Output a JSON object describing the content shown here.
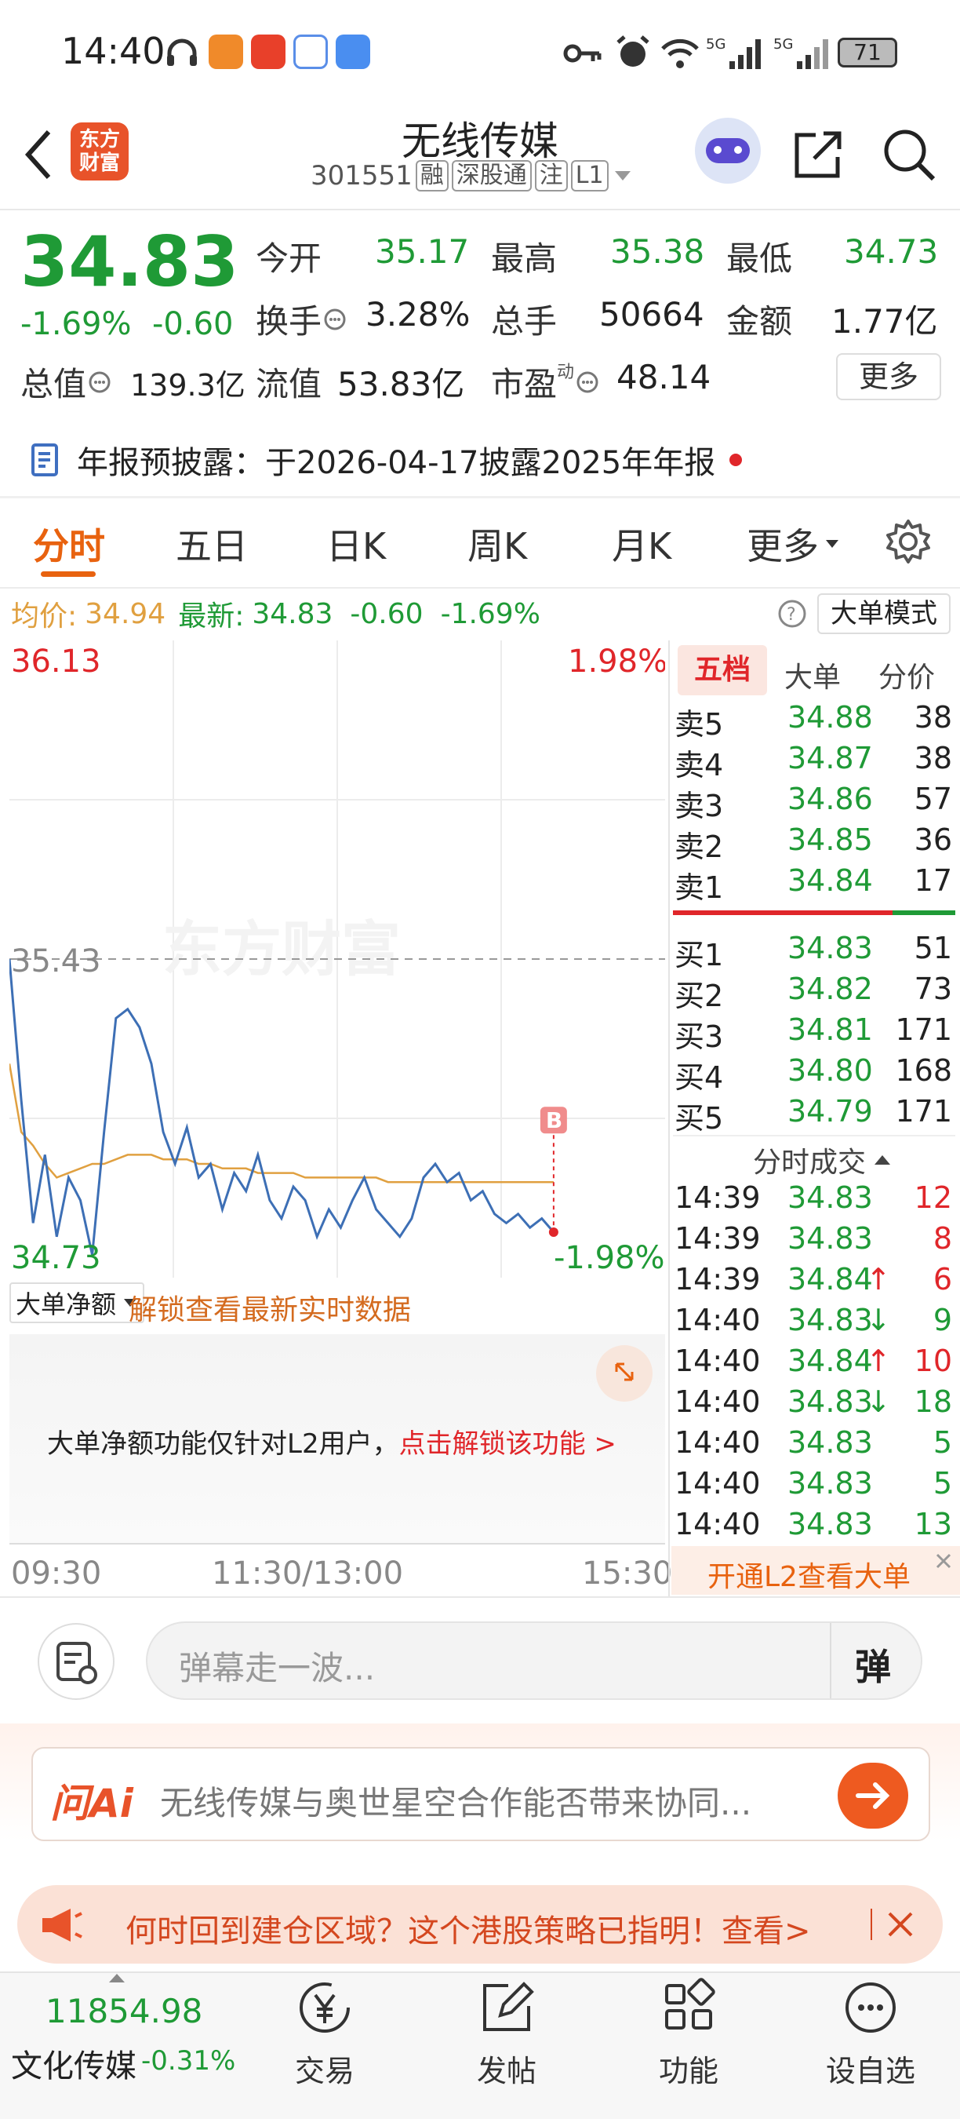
{
  "status_bar": {
    "time": "14:40",
    "battery": "71"
  },
  "header": {
    "logo_text": "东方\n财富",
    "stock_name": "无线传媒",
    "stock_code": "301551",
    "tags": [
      "融",
      "深股通",
      "注",
      "L1"
    ]
  },
  "quote": {
    "price": "34.83",
    "change_pct": "-1.69%",
    "change": "-0.60",
    "fields": [
      {
        "label": "今开",
        "value": "35.17"
      },
      {
        "label": "最高",
        "value": "35.38"
      },
      {
        "label": "最低",
        "value": "34.73"
      },
      {
        "label": "换手",
        "value": "3.28%"
      },
      {
        "label": "总手",
        "value": "50664"
      },
      {
        "label": "金额",
        "value": "1.77亿"
      },
      {
        "label": "总值",
        "value": "139.3亿"
      },
      {
        "label": "流值",
        "value": "53.83亿"
      },
      {
        "label": "市盈",
        "value": "48.14",
        "sup": "动"
      }
    ],
    "more_button": "更多"
  },
  "notice": {
    "text": "年报预披露：于2026-04-17披露2025年年报"
  },
  "tabs": {
    "items": [
      "分时",
      "五日",
      "日K",
      "周K",
      "月K",
      "更多"
    ],
    "active": 0
  },
  "info_line": {
    "avg_label": "均价:",
    "avg_value": "34.94",
    "latest_label": "最新:",
    "latest_value": "34.83",
    "change": "-0.60",
    "change_pct": "-1.69%",
    "mode_button": "大单模式"
  },
  "chart_labels": {
    "top_price": "36.13",
    "top_pct": "1.98%",
    "mid_price": "35.43",
    "bottom_price": "34.73",
    "bottom_pct": "-1.98%",
    "watermark": "东方财富",
    "b_marker": "B",
    "time_start": "09:30",
    "time_mid": "11:30/13:00",
    "time_end": "15:30"
  },
  "chart_data": {
    "type": "line",
    "xlabel": "",
    "ylabel": "",
    "ylim": [
      34.73,
      36.13
    ],
    "series": [
      {
        "values": [
          35.43,
          35.12,
          34.85,
          35.0,
          34.82,
          34.95,
          34.9,
          34.78,
          35.05,
          35.3,
          35.32,
          35.28,
          35.2,
          35.05,
          34.98,
          35.06,
          34.95,
          34.98,
          34.88,
          34.96,
          34.92,
          35.0,
          34.9,
          34.86,
          34.93,
          34.9,
          34.82,
          34.88,
          34.84,
          34.9,
          34.95,
          34.88,
          34.85,
          34.82,
          34.86,
          34.95,
          34.98,
          34.94,
          34.96,
          34.9,
          34.92,
          34.87,
          34.85,
          34.87,
          34.84,
          34.86,
          34.83
        ]
      },
      {
        "values": [
          35.2,
          35.05,
          35.02,
          34.98,
          34.95,
          34.96,
          34.97,
          34.98,
          34.98,
          34.99,
          35.0,
          35.0,
          35.0,
          34.99,
          34.99,
          34.99,
          34.98,
          34.98,
          34.97,
          34.97,
          34.97,
          34.96,
          34.96,
          34.96,
          34.96,
          34.95,
          34.95,
          34.95,
          34.95,
          34.95,
          34.95,
          34.95,
          34.94,
          34.94,
          34.94,
          34.94,
          34.94,
          34.94,
          34.94,
          34.94,
          34.94,
          34.94,
          34.94,
          34.94,
          34.94,
          34.94,
          34.94
        ]
      }
    ]
  },
  "sub_chart": {
    "dropdown": "大单净额",
    "unlock_link": "解锁查看最新实时数据",
    "notice_text": "大单净额功能仅针对L2用户，",
    "notice_link": "点击解锁该功能 >"
  },
  "orderbook": {
    "tabs": [
      "五档",
      "大单",
      "分价"
    ],
    "sell": [
      {
        "label": "卖5",
        "price": "34.88",
        "vol": "38"
      },
      {
        "label": "卖4",
        "price": "34.87",
        "vol": "38"
      },
      {
        "label": "卖3",
        "price": "34.86",
        "vol": "57"
      },
      {
        "label": "卖2",
        "price": "34.85",
        "vol": "36"
      },
      {
        "label": "卖1",
        "price": "34.84",
        "vol": "17"
      }
    ],
    "buy": [
      {
        "label": "买1",
        "price": "34.83",
        "vol": "51"
      },
      {
        "label": "买2",
        "price": "34.82",
        "vol": "73"
      },
      {
        "label": "买3",
        "price": "34.81",
        "vol": "171"
      },
      {
        "label": "买4",
        "price": "34.80",
        "vol": "168"
      },
      {
        "label": "买5",
        "price": "34.79",
        "vol": "171"
      }
    ]
  },
  "trades": {
    "title": "分时成交",
    "rows": [
      {
        "time": "14:39",
        "price": "34.83",
        "arrow": "",
        "vol": "12"
      },
      {
        "time": "14:39",
        "price": "34.83",
        "arrow": "",
        "vol": "8"
      },
      {
        "time": "14:39",
        "price": "34.84",
        "arrow": "↑",
        "vol": "6"
      },
      {
        "time": "14:40",
        "price": "34.83",
        "arrow": "↓",
        "vol": "9"
      },
      {
        "time": "14:40",
        "price": "34.84",
        "arrow": "↑",
        "vol": "10"
      },
      {
        "time": "14:40",
        "price": "34.83",
        "arrow": "↓",
        "vol": "18"
      },
      {
        "time": "14:40",
        "price": "34.83",
        "arrow": "",
        "vol": "5"
      },
      {
        "time": "14:40",
        "price": "34.83",
        "arrow": "",
        "vol": "5"
      },
      {
        "time": "14:40",
        "price": "34.83",
        "arrow": "",
        "vol": "13"
      }
    ],
    "l2_banner": "开通L2查看大单"
  },
  "danmu": {
    "placeholder": "弹幕走一波...",
    "button": "弹"
  },
  "ai_bar": {
    "logo": "问Ai",
    "question": "无线传媒与奥世星空合作能否带来协同..."
  },
  "ad_bar": {
    "text": "何时回到建仓区域？这个港股策略已指明！查看>"
  },
  "bottom_nav": {
    "index_value": "11854.98",
    "index_name": "文化传媒",
    "index_change": "-0.31%",
    "items": [
      "交易",
      "发帖",
      "功能",
      "设自选"
    ]
  },
  "colors": {
    "up": "#e0262a",
    "down": "#1f9a36",
    "accent": "#e8620f",
    "price_line": "#3d6fb5",
    "avg_line": "#e0a040"
  }
}
